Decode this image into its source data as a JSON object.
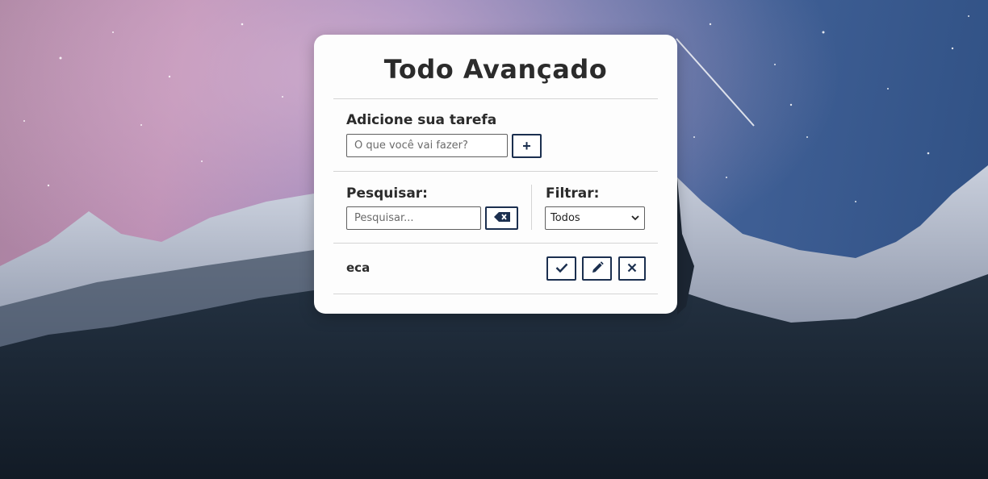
{
  "app": {
    "title": "Todo Avançado"
  },
  "add_section": {
    "label": "Adicione sua tarefa",
    "input_placeholder": "O que você vai fazer?",
    "input_value": "",
    "add_button_label": "+"
  },
  "search_section": {
    "label": "Pesquisar:",
    "input_placeholder": "Pesquisar...",
    "input_value": "",
    "clear_button_icon": "backspace-icon"
  },
  "filter_section": {
    "label": "Filtrar:",
    "selected_option": "Todos",
    "dropdown_icon": "chevron-down-icon"
  },
  "todos": [
    {
      "text": "eca",
      "actions": [
        "check-icon",
        "pencil-icon",
        "close-icon"
      ]
    }
  ],
  "colors": {
    "accent": "#1b2f4f",
    "card_background": "#fdfdfd",
    "text": "#2b2b2b"
  }
}
